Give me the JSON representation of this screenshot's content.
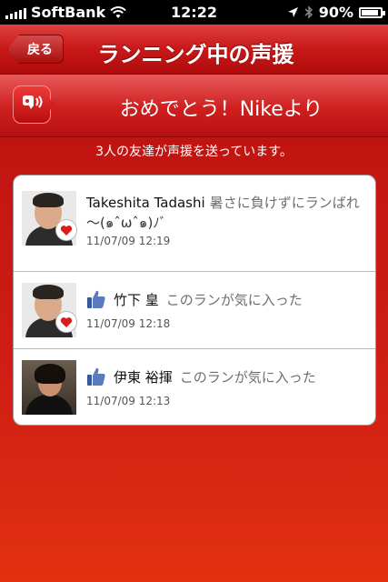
{
  "status_bar": {
    "carrier": "SoftBank",
    "time": "12:22",
    "battery": "90%",
    "battery_level": 0.9,
    "icons": [
      "signal-icon",
      "wifi-icon",
      "location-icon",
      "bluetooth-icon",
      "battery-icon"
    ]
  },
  "nav": {
    "back_label": "戻る",
    "title": "ランニング中の声援"
  },
  "banner": {
    "icon": "cheer-speaker-icon",
    "title": "おめでとう！Nikeより"
  },
  "summary": "3人の友達が声援を送っています。",
  "cheers": [
    {
      "name": "Takeshita Tadashi",
      "message_part1": "暑さに負けずにランばれ",
      "message_part2": "〜(๑ˆωˆ๑)ﾉﾞ",
      "timestamp": "11/07/09  12:19",
      "type": "heart",
      "icon": "heart-icon"
    },
    {
      "name": "竹下 皇",
      "message": "このランが気に入った",
      "timestamp": "11/07/09  12:18",
      "type": "like",
      "icon": "thumbs-up-icon"
    },
    {
      "name": "伊東 裕揮",
      "message": "このランが気に入った",
      "timestamp": "11/07/09  12:13",
      "type": "like",
      "icon": "thumbs-up-icon"
    }
  ],
  "colors": {
    "nike_red": "#c81818",
    "like_blue": "#3b5998"
  }
}
